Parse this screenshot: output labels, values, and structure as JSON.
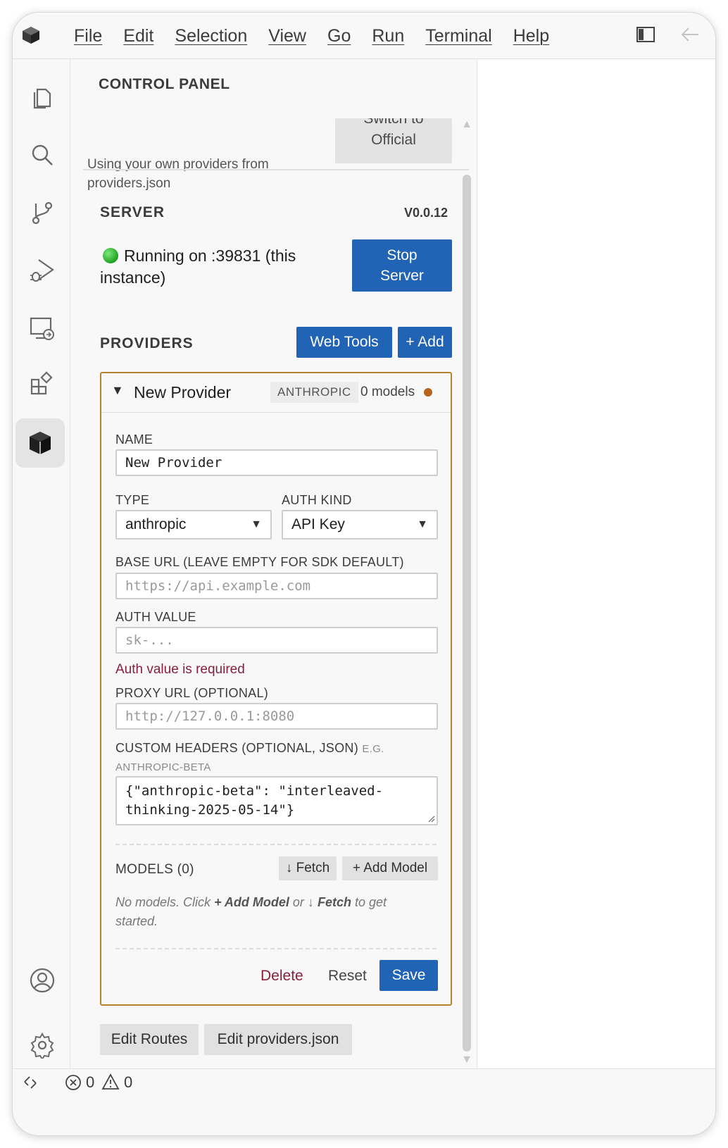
{
  "menu": [
    "File",
    "Edit",
    "Selection",
    "View",
    "Go",
    "Run",
    "Terminal",
    "Help"
  ],
  "activity_icons": [
    "explorer-icon",
    "search-icon",
    "source-control-icon",
    "run-debug-icon",
    "remote-explorer-icon",
    "extensions-icon",
    "provider-cube-icon",
    "account-icon",
    "settings-gear-icon"
  ],
  "panel": {
    "title": "CONTROL PANEL",
    "own_providers_text": "Using your own providers from providers.json",
    "switch_button": "Switch to Official",
    "switch_top": "Switch to",
    "switch_bottom": "Official"
  },
  "server": {
    "heading": "SERVER",
    "version": "V0.0.12",
    "status": "Running on :39831 (this instance)",
    "stop_button_line1": "Stop",
    "stop_button_line2": "Server"
  },
  "providers": {
    "heading": "PROVIDERS",
    "web_tools_button": "Web Tools",
    "add_button": "+ Add"
  },
  "provider_card": {
    "name": "New Provider",
    "type_badge": "ANTHROPIC",
    "model_count": "0 models",
    "name_label": "NAME",
    "name_value": "New Provider",
    "type_label": "TYPE",
    "type_value": "anthropic",
    "auth_kind_label": "AUTH KIND",
    "auth_kind_value": "API Key",
    "base_url_label": "BASE URL (LEAVE EMPTY FOR SDK DEFAULT)",
    "base_url_placeholder": "https://api.example.com",
    "auth_value_label": "AUTH VALUE",
    "auth_value_placeholder": "sk-...",
    "auth_error": "Auth value is required",
    "proxy_label": "PROXY URL (OPTIONAL)",
    "proxy_placeholder": "http://127.0.0.1:8080",
    "headers_label": "CUSTOM HEADERS (OPTIONAL, JSON)",
    "headers_hint_1": "E.G.",
    "headers_hint_2": "ANTHROPIC-BETA",
    "headers_line1": "{\"anthropic-beta\": \"interleaved-",
    "headers_line2": "thinking-2025-05-14\"}",
    "models_label": "MODELS (0)",
    "fetch_button": "↓ Fetch",
    "add_model_button": "+ Add Model",
    "empty_1": "No models. Click",
    "empty_add": "+ Add Model",
    "empty_or": "or ↓",
    "empty_fetch": "Fetch",
    "empty_2": "to get",
    "empty_3": "started.",
    "delete": "Delete",
    "reset": "Reset",
    "save": "Save"
  },
  "footer_buttons": {
    "edit_routes": "Edit Routes",
    "edit_providers": "Edit providers.json"
  },
  "status_bar": {
    "errors": "0",
    "warnings": "0"
  }
}
